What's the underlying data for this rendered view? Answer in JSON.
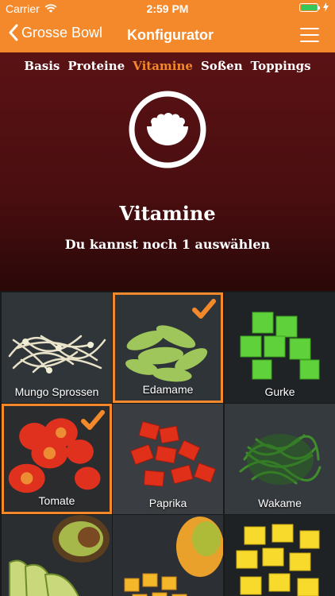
{
  "status_bar": {
    "carrier": "Carrier",
    "time": "2:59 PM"
  },
  "nav": {
    "back_label": "Grosse Bowl",
    "title": "Konfigurator"
  },
  "tabs": [
    {
      "label": "Basis",
      "active": false
    },
    {
      "label": "Proteine",
      "active": false
    },
    {
      "label": "Vitamine",
      "active": true
    },
    {
      "label": "Soßen",
      "active": false
    },
    {
      "label": "Toppings",
      "active": false
    }
  ],
  "section": {
    "title": "Vitamine",
    "subtitle": "Du kannst noch 1 auswählen"
  },
  "items": [
    {
      "label": "Mungo Sprossen",
      "selected": false,
      "icon": "bean-sprouts"
    },
    {
      "label": "Edamame",
      "selected": true,
      "icon": "edamame"
    },
    {
      "label": "Gurke",
      "selected": false,
      "icon": "cucumber"
    },
    {
      "label": "Tomate",
      "selected": true,
      "icon": "tomato"
    },
    {
      "label": "Paprika",
      "selected": false,
      "icon": "paprika"
    },
    {
      "label": "Wakame",
      "selected": false,
      "icon": "wakame"
    },
    {
      "label": "",
      "selected": false,
      "icon": "avocado"
    },
    {
      "label": "",
      "selected": false,
      "icon": "mango"
    },
    {
      "label": "",
      "selected": false,
      "icon": "pineapple"
    }
  ],
  "colors": {
    "accent": "#f3892a",
    "header_bg": "#4a0e10",
    "battery": "#35c759"
  }
}
